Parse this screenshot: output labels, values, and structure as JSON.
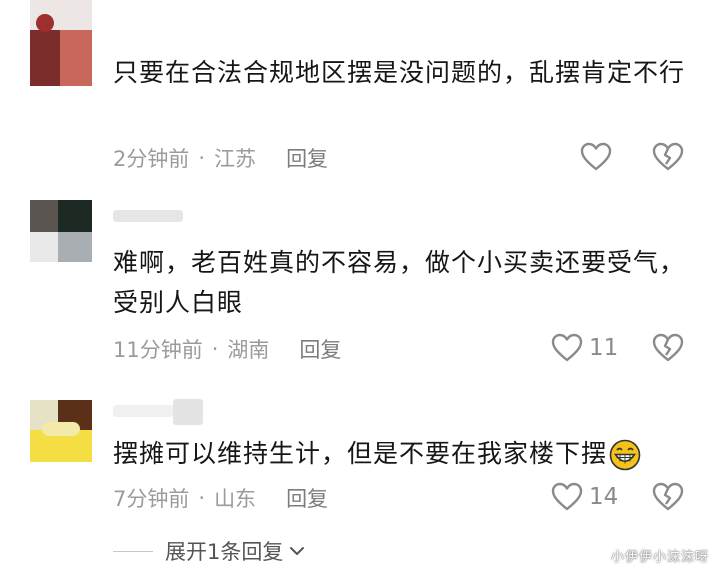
{
  "comments": [
    {
      "text": "只要在合法合规地区摆是没问题的，乱摆肯定不行",
      "time": "2分钟前",
      "location": "江苏",
      "reply_label": "回复",
      "like_count": ""
    },
    {
      "text": "难啊，老百姓真的不容易，做个小买卖还要受气，受别人白眼",
      "time": "11分钟前",
      "location": "湖南",
      "reply_label": "回复",
      "like_count": "11"
    },
    {
      "text": "摆摊可以维持生计，但是不要在我家楼下摆",
      "time": "7分钟前",
      "location": "山东",
      "reply_label": "回复",
      "like_count": "14"
    }
  ],
  "separator": "·",
  "expand_label": "展开1条回复",
  "watermark": "小伊伊小沫沫呀",
  "icons": {
    "like": "heart-outline-icon",
    "dislike": "broken-heart-icon",
    "expand": "chevron-down-icon",
    "emoji": "grinning-face-icon"
  },
  "colors": {
    "meta_text": "#9b9b9b",
    "icon": "#8a8a8a",
    "emoji_fill": "#f5c21b"
  }
}
